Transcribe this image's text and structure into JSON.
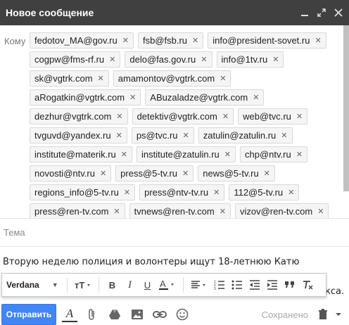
{
  "window": {
    "title": "Новое сообщение",
    "controls": [
      "minimize-icon",
      "popout-icon",
      "close-icon"
    ]
  },
  "recipients": {
    "label": "Кому",
    "chips": [
      "fedotov_MA@gov.ru",
      "fsb@fsb.ru",
      "info@president-sovet.ru",
      "cogpw@fms-rf.ru",
      "delo@fas.gov.ru",
      "info@1tv.ru",
      "sk@vgtrk.com",
      "amamontov@vgtrk.com",
      "aRogatkin@vgtrk.com",
      "ABuzaladze@vgtrk.com",
      "dezhur@vgtrk.com",
      "detektiv@vgtrk.com",
      "web@tvc.ru",
      "tvguvd@yandex.ru",
      "ps@tvc.ru",
      "zatulin@zatulin.ru",
      "institute@materik.ru",
      "institute@zatulin.ru",
      "chp@ntv.ru",
      "novosti@ntv.ru",
      "press@5-tv.ru",
      "news@5-tv.ru",
      "regions_info@5-tv.ru",
      "press@ntv-tv.ru",
      "112@5-tv.ru",
      "press@ren-tv.com",
      "tvnews@ren-tv.com",
      "vizov@ren-tv.com"
    ]
  },
  "subject": {
    "placeholder": "Тема"
  },
  "body": {
    "line1": "Вторую неделю полиция и волонтеры ищут 18-летнюю Катю",
    "tail": "кса."
  },
  "format_toolbar": {
    "font": "Verdana",
    "buttons": [
      "text-size-icon",
      "bold-icon",
      "italic-icon",
      "underline-icon",
      "text-color-icon",
      "align-icon",
      "numbered-list-icon",
      "bulleted-list-icon",
      "indent-less-icon",
      "indent-more-icon",
      "quote-icon",
      "clear-format-icon"
    ]
  },
  "bottom": {
    "send_label": "Отправить",
    "saved_label": "Сохранено"
  }
}
